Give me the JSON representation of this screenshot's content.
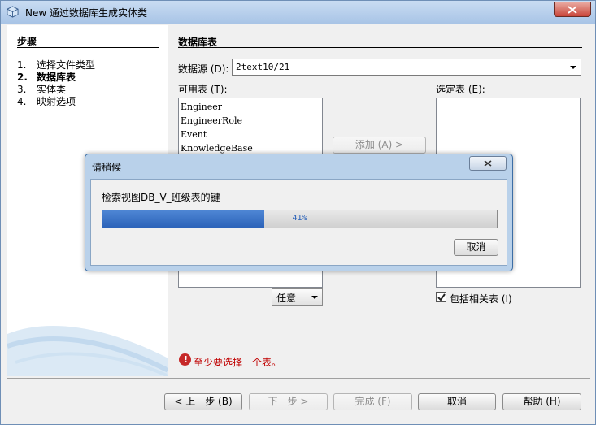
{
  "window": {
    "title": "New 通过数据库生成实体类"
  },
  "steps": {
    "title": "步骤",
    "items": [
      {
        "num": "1.",
        "label": "选择文件类型",
        "active": false
      },
      {
        "num": "2.",
        "label": "数据库表",
        "active": true
      },
      {
        "num": "3.",
        "label": "实体类",
        "active": false
      },
      {
        "num": "4.",
        "label": "映射选项",
        "active": false
      }
    ]
  },
  "main": {
    "title": "数据库表",
    "datasource_label": "数据源 (D):",
    "datasource_value": "2text10/21",
    "available_label": "可用表 (T):",
    "selected_label": "选定表 (E):",
    "available_tables": [
      "Engineer",
      "EngineerRole",
      "Event",
      "KnowledgeBase"
    ],
    "add_button": "添加 (A) >",
    "filter_value": "任意",
    "include_related_label": "包括相关表 (I)",
    "include_related_checked": true,
    "error_message": "至少要选择一个表。"
  },
  "footer": {
    "back": "< 上一步 (B)",
    "next": "下一步 >",
    "finish": "完成 (F)",
    "cancel": "取消",
    "help": "帮助 (H)"
  },
  "progress_dialog": {
    "title": "请稍候",
    "message": "检索视图DB_V_班级表的键",
    "progress_text": "41%",
    "progress_fraction": 0.41,
    "cancel": "取消"
  },
  "colors": {
    "accent": "#2c63b9",
    "error": "#c00000",
    "titlebar": "#b9d1ea"
  }
}
